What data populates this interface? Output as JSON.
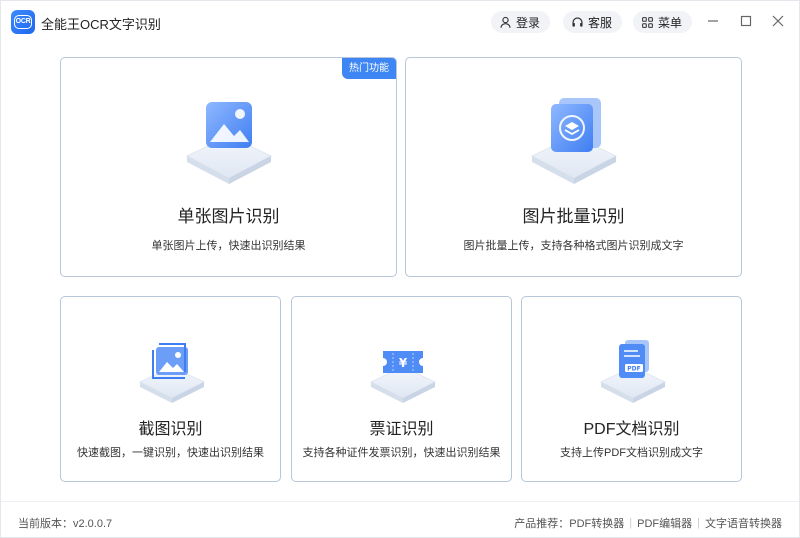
{
  "app": {
    "title": "全能王OCR文字识别",
    "logo_text": "OCR"
  },
  "header": {
    "login_label": "登录",
    "service_label": "客服",
    "menu_label": "菜单"
  },
  "cards": {
    "single": {
      "title": "单张图片识别",
      "desc": "单张图片上传，快速出识别结果",
      "badge": "热门功能"
    },
    "batch": {
      "title": "图片批量识别",
      "desc": "图片批量上传，支持各种格式图片识别成文字"
    },
    "screenshot": {
      "title": "截图识别",
      "desc": "快速截图，一键识别，快速出识别结果"
    },
    "ticket": {
      "title": "票证识别",
      "desc": "支持各种证件发票识别，快速出识别结果"
    },
    "pdf": {
      "title": "PDF文档识别",
      "desc": "支持上传PDF文档识别成文字"
    }
  },
  "footer": {
    "version": "当前版本：v2.0.0.7",
    "products_label": "产品推荐：",
    "products": [
      "PDF转换器",
      "PDF编辑器",
      "文字语音转换器"
    ]
  },
  "colors": {
    "accent": "#3f86f5",
    "card_border": "#b7c6d9"
  }
}
